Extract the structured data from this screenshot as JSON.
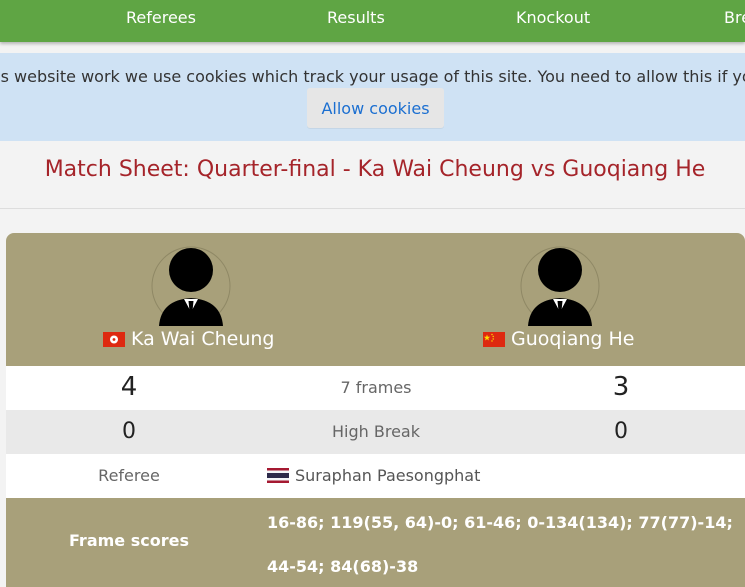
{
  "nav": {
    "items": [
      "Referees",
      "Results",
      "Knockout",
      "Bre"
    ]
  },
  "cookie_banner": {
    "text": "his website work we use cookies which track your usage of this site. You need to allow this if yo",
    "button_label": "Allow cookies"
  },
  "page": {
    "title": "Match Sheet: Quarter-final - Ka Wai Cheung vs Guoqiang He"
  },
  "match": {
    "player1": {
      "name": "Ka Wai Cheung",
      "flag": "hong-kong-flag-icon",
      "frames": "4",
      "high_break": "0"
    },
    "player2": {
      "name": "Guoqiang He",
      "flag": "china-flag-icon",
      "frames": "3",
      "high_break": "0"
    },
    "frames_label": "7 frames",
    "high_break_label": "High Break",
    "referee_label": "Referee",
    "referee_name": "Suraphan Paesongphat",
    "referee_flag": "thailand-flag-icon",
    "frame_scores_label": "Frame scores",
    "frame_scores": "16-86; 119(55, 64)-0; 61-46; 0-134(134); 77(77)-14; 44-54; 84(68)-38"
  },
  "colors": {
    "nav_bg": "#5fa544",
    "cookie_bg": "#cfe2f4",
    "title_color": "#a5242a",
    "card_bg": "#a8a07a"
  }
}
